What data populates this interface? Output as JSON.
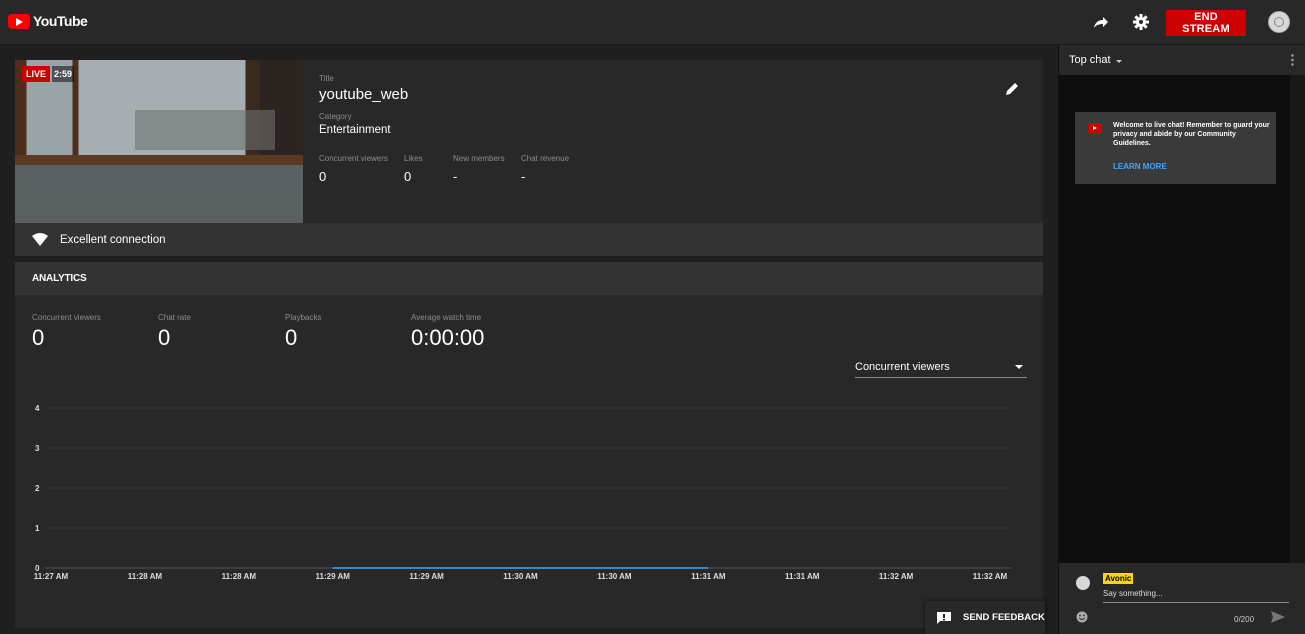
{
  "header": {
    "logo_text": "YouTube",
    "end_stream_label": "END STREAM"
  },
  "stream": {
    "live_badge": "LIVE",
    "elapsed": "2:59",
    "title_label": "Title",
    "title": "youtube_web",
    "category_label": "Category",
    "category": "Entertainment",
    "stats": [
      {
        "label": "Concurrent viewers",
        "value": "0"
      },
      {
        "label": "Likes",
        "value": "0"
      },
      {
        "label": "New members",
        "value": "-"
      },
      {
        "label": "Chat revenue",
        "value": "-"
      }
    ],
    "connection": "Excellent connection"
  },
  "analytics": {
    "heading": "ANALYTICS",
    "stats": [
      {
        "label": "Concurrent viewers",
        "value": "0"
      },
      {
        "label": "Chat rate",
        "value": "0"
      },
      {
        "label": "Playbacks",
        "value": "0"
      },
      {
        "label": "Average watch time",
        "value": "0:00:00"
      }
    ],
    "metric_selected": "Concurrent viewers"
  },
  "chart_data": {
    "type": "line",
    "x": [
      "11:27 AM",
      "11:28 AM",
      "11:28 AM",
      "11:29 AM",
      "11:29 AM",
      "11:30 AM",
      "11:30 AM",
      "11:31 AM",
      "11:31 AM",
      "11:32 AM",
      "11:32 AM"
    ],
    "y_ticks": [
      0,
      1,
      2,
      3,
      4
    ],
    "ylim": [
      0,
      4
    ],
    "series": [
      {
        "values": [
          null,
          null,
          null,
          0,
          0,
          0,
          0,
          0,
          null,
          null,
          null
        ],
        "color": "#3ea6ff"
      }
    ],
    "grid": true
  },
  "feedback_label": "SEND FEEDBACK",
  "chat": {
    "mode": "Top chat",
    "welcome_text": "Welcome to live chat! Remember to guard your privacy and abide by our Community Guidelines.",
    "learn_more": "LEARN MORE",
    "username": "Avonic",
    "placeholder": "Say something...",
    "counter": "0/200"
  },
  "colors": {
    "accent_red": "#cc0000",
    "link_blue": "#3ea6ff",
    "username_badge": "#ffd600"
  }
}
